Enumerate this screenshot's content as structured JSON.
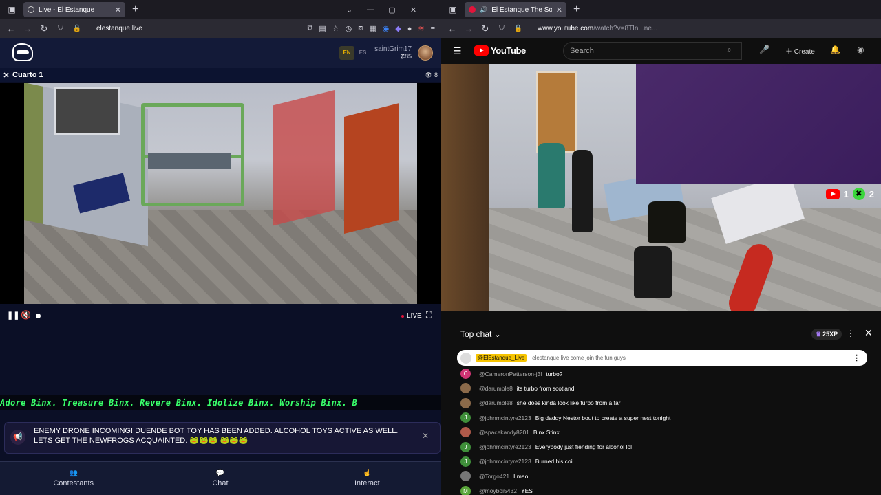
{
  "left_browser": {
    "tab_title": "Live - El Estanque",
    "url": "elestanque.live"
  },
  "left_site": {
    "lang_en": "EN",
    "lang_es": "ES",
    "username": "saintGrim17",
    "coins": "₡85",
    "room_title": "Cuarto 1",
    "viewer_count": "8",
    "live_label": "LIVE",
    "ticker_text": "Adore Binx. Treasure Binx. Revere Binx. Idolize Binx. Worship Binx. B",
    "alert_text": "ENEMY DRONE INCOMING! DUENDE BOT TOY HAS BEEN ADDED. ALCOHOL TOYS ACTIVE AS WELL. LETS GET THE NEWFROGS ACQUAINTED. 🐸🐸🐸 🐸🐸🐸",
    "nav": {
      "contestants": "Contestants",
      "chat": "Chat",
      "interact": "Interact"
    }
  },
  "right_browser": {
    "tab_title": "El Estanque The Social Exp",
    "url_main": "www.youtube.com",
    "url_rest": "/watch?v=8TIn...ne..."
  },
  "youtube": {
    "logo_text": "YouTube",
    "search_placeholder": "Search",
    "create_label": "Create",
    "counter_youtube": "1",
    "counter_kick": "2",
    "chat_title": "Top chat",
    "xp_label": "25XP",
    "pinned": {
      "author": "@ElEstanque_Live",
      "text": "elestanque.live come join the fun guys"
    },
    "messages": [
      {
        "initial": "C",
        "color": "#d03474",
        "author": "@CameronPatterson-j3l",
        "text": "turbo?"
      },
      {
        "initial": "",
        "color": "#8b6a4a",
        "author": "@darumble8",
        "text": "its turbo from scotland"
      },
      {
        "initial": "",
        "color": "#8b6a4a",
        "author": "@darumble8",
        "text": "she does kinda look like turbo from a far"
      },
      {
        "initial": "J",
        "color": "#3f8f3a",
        "author": "@johnmcintyre2123",
        "text": "Big daddy Nestor bout to create a super nest tonight"
      },
      {
        "initial": "",
        "color": "#b05a4a",
        "author": "@spacekandy8201",
        "text": "Binx Stinx"
      },
      {
        "initial": "J",
        "color": "#3f8f3a",
        "author": "@johnmcintyre2123",
        "text": "Everybody just fiending for alcohol lol"
      },
      {
        "initial": "J",
        "color": "#3f8f3a",
        "author": "@johnmcintyre2123",
        "text": "Burned his coil"
      },
      {
        "initial": "",
        "color": "#777777",
        "author": "@Torgo421",
        "text": "Lmao"
      },
      {
        "initial": "M",
        "color": "#5aa53a",
        "author": "@moyboi5432",
        "text": "YES"
      }
    ]
  }
}
